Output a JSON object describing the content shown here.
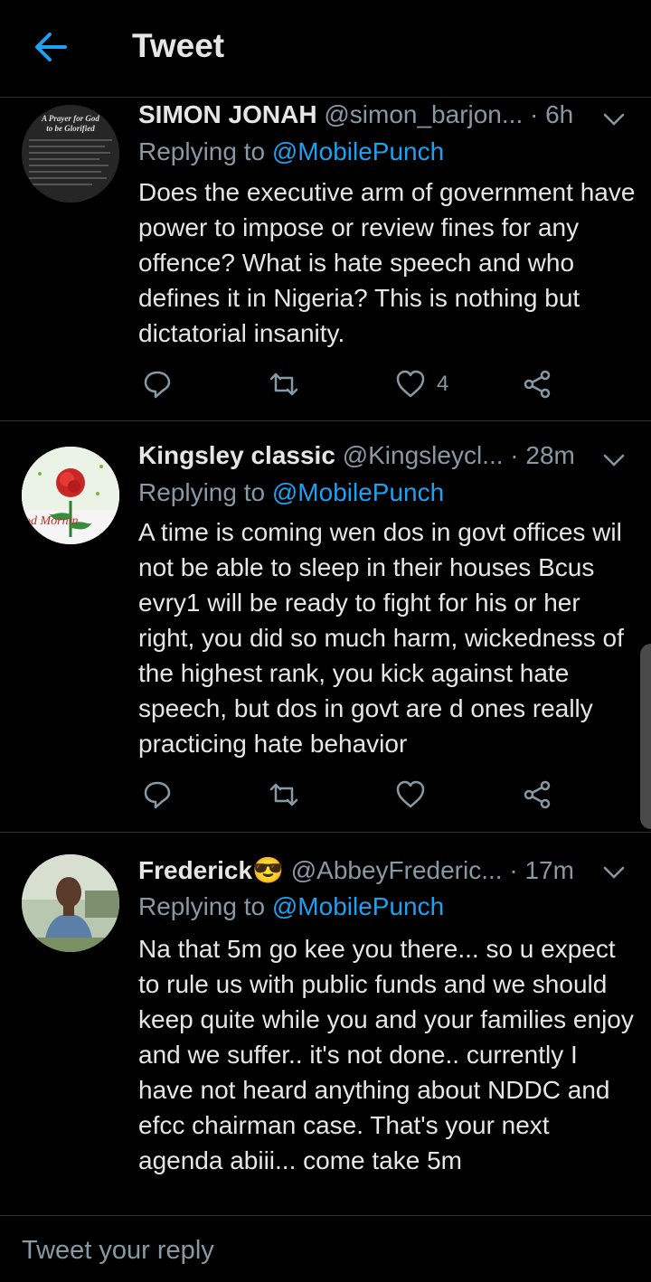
{
  "header": {
    "title": "Tweet"
  },
  "tweets": [
    {
      "name": "SIMON JONAH",
      "handle": "@simon_barjon...",
      "time": "· 6h",
      "replying_prefix": "Replying to ",
      "replying_to": "@MobilePunch",
      "text": "Does the executive arm of government have power to impose or review fines for any offence? What is hate speech and who defines it in Nigeria? This is nothing but dictatorial insanity.",
      "like_count": "4",
      "avatar_title": "A Prayer for God to be Glorified"
    },
    {
      "name": "Kingsley classic",
      "handle": "@Kingsleycl...",
      "time": "· 28m",
      "replying_prefix": "Replying to ",
      "replying_to": "@MobilePunch",
      "text": "A time is coming wen dos in govt offices wil not be able to sleep in their houses Bcus evry1 will be ready to fight for his or her right, you did so much harm, wickedness of the highest rank, you kick against hate speech, but dos in govt are d ones really practicing hate behavior",
      "avatar_caption": "ood Mornin"
    },
    {
      "name": "Frederick😎",
      "handle": "@AbbeyFrederic...",
      "time": "· 17m",
      "replying_prefix": "Replying to ",
      "replying_to": "@MobilePunch",
      "text": "Na that 5m go kee you there... so u expect to rule us with public funds and we should keep quite while you and your families enjoy and we suffer.. it's not done.. currently I have not heard anything about NDDC and efcc chairman case. That's your next agenda abiii... come take 5m"
    }
  ],
  "composer": {
    "placeholder": "Tweet your reply"
  },
  "colors": {
    "accent": "#1da1f2",
    "muted": "#8899a6",
    "divider": "#2f3336"
  },
  "icons": [
    "back-arrow-icon",
    "chevron-down-icon",
    "reply-icon",
    "retweet-icon",
    "like-icon",
    "share-icon"
  ]
}
